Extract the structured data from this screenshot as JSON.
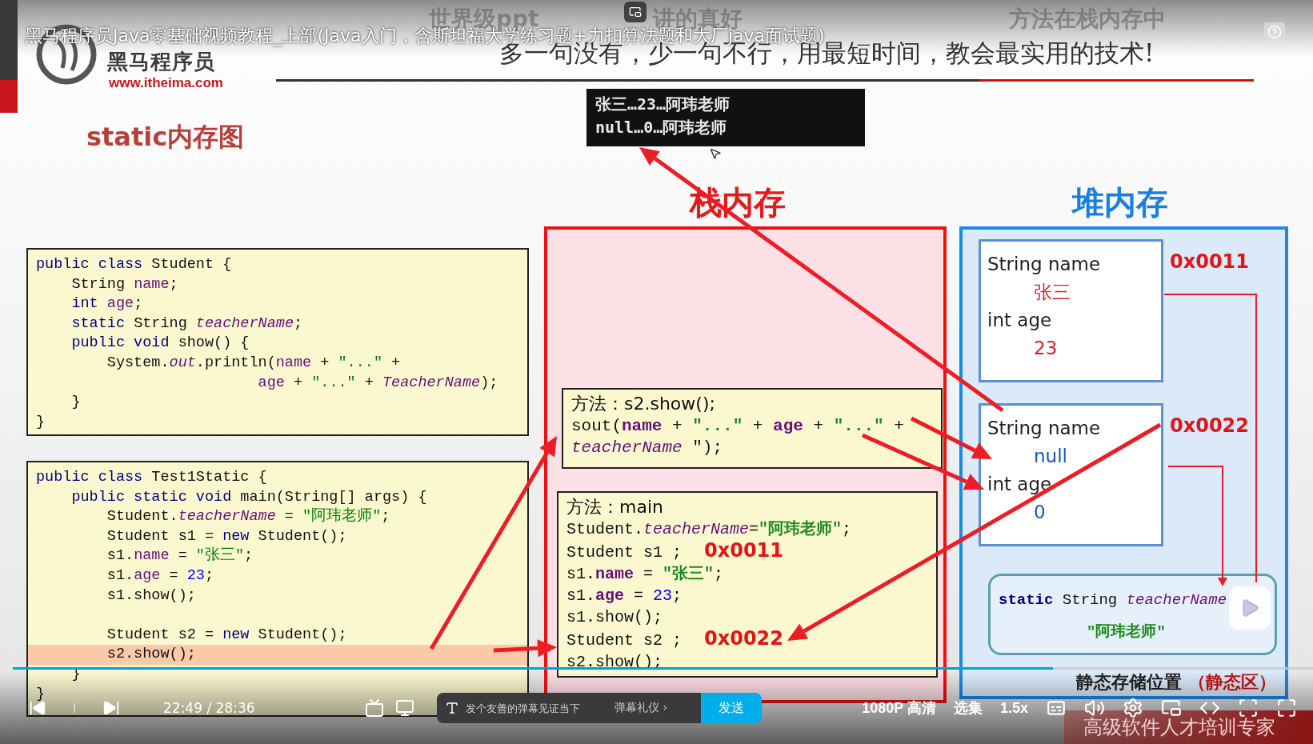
{
  "video_title": "黑马程序员Java零基础视频教程_上部(Java入门，含斯坦福大学练习题+力扣算法题和大厂java面试题)",
  "danmaku": [
    "世界级ppt",
    "讲的真好",
    "方法在栈内存中"
  ],
  "slide": {
    "logo_name": "黑马程序员",
    "logo_url": "www.itheima.com",
    "slogan": "多一句没有，少一句不行，用最短时间，教会最实用的技术!",
    "title": "static内存图",
    "console_lines": [
      "张三…23…阿玮老师",
      "null…0…阿玮老师"
    ],
    "stack_title": "栈内存",
    "heap_title": "堆内存",
    "code_student": [
      [
        {
          "kind": "kw",
          "text": "public class"
        },
        {
          "kind": "txt",
          "text": " Student {"
        }
      ],
      [
        {
          "kind": "txt",
          "text": "    String "
        },
        {
          "kind": "var",
          "text": "name"
        },
        {
          "kind": "txt",
          "text": ";"
        }
      ],
      [
        {
          "kind": "kw",
          "text": "    int"
        },
        {
          "kind": "var",
          "text": " age"
        },
        {
          "kind": "txt",
          "text": ";"
        }
      ],
      [
        {
          "kind": "kw",
          "text": "    static"
        },
        {
          "kind": "txt",
          "text": " String "
        },
        {
          "kind": "ital",
          "text": "teacherName"
        },
        {
          "kind": "txt",
          "text": ";"
        }
      ],
      [
        {
          "kind": "kw",
          "text": "    public void"
        },
        {
          "kind": "txt",
          "text": " show() {"
        }
      ],
      [
        {
          "kind": "txt",
          "text": "        System."
        },
        {
          "kind": "ital",
          "text": "out"
        },
        {
          "kind": "txt",
          "text": ".println("
        },
        {
          "kind": "var",
          "text": "name"
        },
        {
          "kind": "txt",
          "text": " + "
        },
        {
          "kind": "str",
          "text": "\"...\""
        },
        {
          "kind": "txt",
          "text": " +"
        }
      ],
      [
        {
          "kind": "var",
          "text": "                         age"
        },
        {
          "kind": "txt",
          "text": " + "
        },
        {
          "kind": "str",
          "text": "\"...\""
        },
        {
          "kind": "txt",
          "text": " + "
        },
        {
          "kind": "ital",
          "text": "TeacherName"
        },
        {
          "kind": "txt",
          "text": ");"
        }
      ],
      [
        {
          "kind": "txt",
          "text": "    }"
        }
      ],
      [
        {
          "kind": "txt",
          "text": "}"
        }
      ]
    ],
    "code_test": [
      [
        {
          "highlighted": false,
          "segments": [
            {
              "kind": "kw",
              "text": "public class"
            },
            {
              "kind": "txt",
              "text": " Test1Static {"
            }
          ]
        },
        {
          "highlighted": false,
          "segments": [
            {
              "kind": "kw",
              "text": "    public static void"
            },
            {
              "kind": "txt",
              "text": " main(String[] args) {"
            }
          ]
        },
        {
          "highlighted": false,
          "segments": [
            {
              "kind": "txt",
              "text": "        Student."
            },
            {
              "kind": "ital",
              "text": "teacherName"
            },
            {
              "kind": "txt",
              "text": " = "
            },
            {
              "kind": "str",
              "text": "\"阿玮老师\""
            },
            {
              "kind": "txt",
              "text": ";"
            }
          ]
        },
        {
          "highlighted": false,
          "segments": [
            {
              "kind": "txt",
              "text": "        Student s1 = "
            },
            {
              "kind": "kw",
              "text": "new"
            },
            {
              "kind": "txt",
              "text": " Student();"
            }
          ]
        },
        {
          "highlighted": false,
          "segments": [
            {
              "kind": "txt",
              "text": "        s1."
            },
            {
              "kind": "var",
              "text": "name"
            },
            {
              "kind": "txt",
              "text": " = "
            },
            {
              "kind": "str",
              "text": "\"张三\""
            },
            {
              "kind": "txt",
              "text": ";"
            }
          ]
        },
        {
          "highlighted": false,
          "segments": [
            {
              "kind": "txt",
              "text": "        s1."
            },
            {
              "kind": "var",
              "text": "age"
            },
            {
              "kind": "txt",
              "text": " = "
            },
            {
              "kind": "num",
              "text": "23"
            },
            {
              "kind": "txt",
              "text": ";"
            }
          ]
        },
        {
          "highlighted": false,
          "segments": [
            {
              "kind": "txt",
              "text": "        s1.show();"
            }
          ]
        }
      ],
      [
        {
          "highlighted": false,
          "segments": [
            {
              "kind": "txt",
              "text": "        Student s2 = "
            },
            {
              "kind": "kw",
              "text": "new"
            },
            {
              "kind": "txt",
              "text": " Student();"
            }
          ]
        },
        {
          "highlighted": true,
          "segments": [
            {
              "kind": "txt",
              "text": "        s2.show();"
            }
          ]
        },
        {
          "highlighted": false,
          "segments": [
            {
              "kind": "txt",
              "text": "    }"
            }
          ]
        },
        {
          "highlighted": false,
          "segments": [
            {
              "kind": "txt",
              "text": "}"
            }
          ]
        }
      ]
    ],
    "show_frame": {
      "header": "方法：s2.show();",
      "lines": [
        [
          {
            "kind": "txt",
            "text": "sout("
          },
          {
            "kind": "prop",
            "text": "name"
          },
          {
            "kind": "txt",
            "text": " + "
          },
          {
            "kind": "strb",
            "text": "\"...\""
          },
          {
            "kind": "txt",
            "text": " + "
          },
          {
            "kind": "prop",
            "text": "age"
          },
          {
            "kind": "txt",
            "text": " + "
          },
          {
            "kind": "strb",
            "text": "\"...\""
          },
          {
            "kind": "txt",
            "text": " +"
          }
        ],
        [
          {
            "kind": "ital",
            "text": "teacherName"
          },
          {
            "kind": "txt",
            "text": " \");"
          }
        ]
      ]
    },
    "main_frame": {
      "header": "方法：main",
      "lines": [
        [
          {
            "kind": "txt",
            "text": "Student."
          },
          {
            "kind": "ital",
            "text": "teacherName"
          },
          {
            "kind": "txt",
            "text": "="
          },
          {
            "kind": "strb",
            "text": "\"阿玮老师\""
          },
          {
            "kind": "txt",
            "text": ";"
          }
        ],
        [
          {
            "kind": "txt",
            "text": "Student s1 ;"
          },
          {
            "kind": "addr",
            "text": "0x0011"
          }
        ],
        [
          {
            "kind": "txt",
            "text": "s1."
          },
          {
            "kind": "prop",
            "text": "name"
          },
          {
            "kind": "txt",
            "text": " = "
          },
          {
            "kind": "strb",
            "text": "\"张三\""
          },
          {
            "kind": "txt",
            "text": ";"
          }
        ],
        [
          {
            "kind": "txt",
            "text": "s1."
          },
          {
            "kind": "prop",
            "text": "age"
          },
          {
            "kind": "txt",
            "text": " = "
          },
          {
            "kind": "num",
            "text": "23"
          },
          {
            "kind": "txt",
            "text": ";"
          }
        ],
        [
          {
            "kind": "txt",
            "text": "s1.show();"
          }
        ],
        [
          {
            "kind": "txt",
            "text": "Student s2 ;"
          },
          {
            "kind": "addr",
            "text": "0x0022"
          }
        ],
        [
          {
            "kind": "txt",
            "text": "s2.show();"
          }
        ]
      ]
    },
    "objects": [
      {
        "address": "0x0011",
        "fields": [
          {
            "label": "String name",
            "value": "张三",
            "color": "#e02020"
          },
          {
            "label": "int age",
            "value": "23",
            "color": "#e02020"
          }
        ]
      },
      {
        "address": "0x0022",
        "fields": [
          {
            "label": "String name",
            "value": "null",
            "color": "#1a56c8"
          },
          {
            "label": "int age",
            "value": "0",
            "color": "#1a56c8"
          }
        ]
      }
    ],
    "static_area": [
      [
        {
          "kind": "kwb",
          "text": "static"
        },
        {
          "kind": "txt",
          "text": " String "
        },
        {
          "kind": "ital",
          "text": "teacherName"
        }
      ],
      [
        {
          "kind": "strb",
          "text": "\"阿玮老师\""
        }
      ]
    ],
    "static_caption": "静态存储位置",
    "static_caption_note": "（静态区）",
    "footer": "高级软件人才培训专家"
  },
  "player": {
    "time": "22:49 / 28:36",
    "progress": {
      "level": 0.8
    },
    "danmaku_placeholder": "发个友善的弹幕见证当下",
    "etiquette": "弹幕礼仪 ›",
    "send": "发送",
    "quality": "1080P 高清",
    "episodes": "选集",
    "speed": "1.5x"
  }
}
